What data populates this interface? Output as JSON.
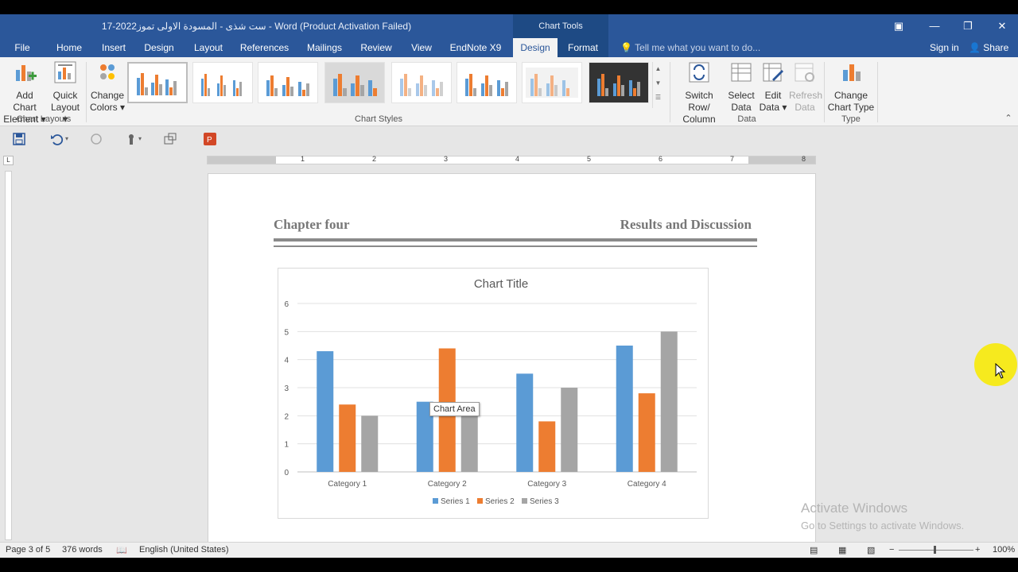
{
  "window": {
    "title": "17-2022ست شذى - المسودة الاولى تموز - Word (Product Activation Failed)",
    "contextual_group": "Chart Tools"
  },
  "tabs": [
    {
      "label": "File"
    },
    {
      "label": "Home"
    },
    {
      "label": "Insert"
    },
    {
      "label": "Design"
    },
    {
      "label": "Layout"
    },
    {
      "label": "References"
    },
    {
      "label": "Mailings"
    },
    {
      "label": "Review"
    },
    {
      "label": "View"
    },
    {
      "label": "EndNote X9"
    },
    {
      "label": "Design"
    },
    {
      "label": "Format"
    }
  ],
  "tell_me": "Tell me what you want to do...",
  "sign_in": "Sign in",
  "share": "Share",
  "ribbon": {
    "add_chart_element": [
      "Add Chart",
      "Element"
    ],
    "quick_layout": [
      "Quick",
      "Layout"
    ],
    "change_colors": [
      "Change",
      "Colors"
    ],
    "switch_row_column": [
      "Switch Row/",
      "Column"
    ],
    "select_data": [
      "Select",
      "Data"
    ],
    "edit_data": [
      "Edit",
      "Data"
    ],
    "refresh_data": [
      "Refresh",
      "Data"
    ],
    "change_chart_type": [
      "Change",
      "Chart Type"
    ],
    "groups": {
      "chart_layouts": "Chart Layouts",
      "chart_styles": "Chart Styles",
      "data": "Data",
      "type": "Type"
    }
  },
  "ruler_numbers": [
    "1",
    "2",
    "3",
    "4",
    "5",
    "6",
    "7",
    "8"
  ],
  "document": {
    "header_left": "Chapter four",
    "header_right": "Results and Discussion"
  },
  "tooltip": "Chart Area",
  "chart_data": {
    "type": "bar",
    "title": "Chart Title",
    "categories": [
      "Category 1",
      "Category 2",
      "Category 3",
      "Category 4"
    ],
    "series": [
      {
        "name": "Series 1",
        "values": [
          4.3,
          2.5,
          3.5,
          4.5
        ],
        "color": "#5b9bd5"
      },
      {
        "name": "Series 2",
        "values": [
          2.4,
          4.4,
          1.8,
          2.8
        ],
        "color": "#ed7d31"
      },
      {
        "name": "Series 3",
        "values": [
          2,
          2,
          3,
          5
        ],
        "color": "#a5a5a5"
      }
    ],
    "ylim": [
      0,
      6
    ],
    "yticks": [
      "0",
      "1",
      "2",
      "3",
      "4",
      "5",
      "6"
    ],
    "grid": true,
    "legend": "bottom"
  },
  "status": {
    "page": "Page 3 of 5",
    "words": "376 words",
    "language": "English (United States)",
    "zoom": "100%"
  },
  "watermark": {
    "line1": "Activate Windows",
    "line2": "Go to Settings to activate Windows."
  }
}
